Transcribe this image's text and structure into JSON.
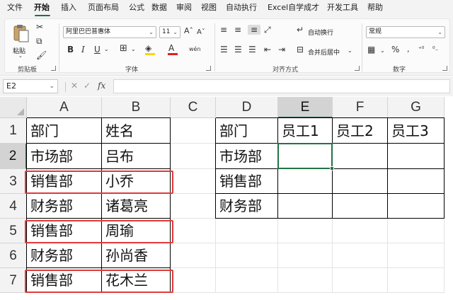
{
  "menu": {
    "items": [
      "文件",
      "开始",
      "插入",
      "页面布局",
      "公式",
      "数据",
      "审阅",
      "视图",
      "自动执行",
      "Excel自学成才",
      "开发工具",
      "帮助"
    ],
    "active_index": 1
  },
  "ribbon": {
    "clipboard": {
      "paste_label": "粘贴",
      "group_label": "剪贴板"
    },
    "font": {
      "font_name": "阿里巴巴普惠体",
      "font_size": "11",
      "group_label": "字体",
      "grow_icon": "Aˆ",
      "shrink_icon": "Aˇ",
      "phonetic_icon": "wén"
    },
    "alignment": {
      "wrap_label": "自动换行",
      "merge_label": "合并后居中",
      "group_label": "对齐方式"
    },
    "number": {
      "format": "常规",
      "group_label": "数字"
    }
  },
  "formula_bar": {
    "name_box": "E2",
    "cancel_icon": "✕",
    "enter_icon": "✓",
    "fx_icon": "fx",
    "formula": ""
  },
  "sheet": {
    "columns": [
      "A",
      "B",
      "C",
      "D",
      "E",
      "F",
      "G"
    ],
    "rows": [
      "1",
      "2",
      "3",
      "4",
      "5",
      "6",
      "7"
    ],
    "active_cell": "E2",
    "cells": {
      "A": [
        "部门",
        "市场部",
        "销售部",
        "财务部",
        "销售部",
        "财务部",
        "销售部"
      ],
      "B": [
        "姓名",
        "吕布",
        "小乔",
        "诸葛亮",
        "周瑜",
        "孙尚香",
        "花木兰"
      ],
      "C": [
        "",
        "",
        "",
        "",
        "",
        "",
        ""
      ],
      "D": [
        "部门",
        "市场部",
        "销售部",
        "财务部",
        "",
        "",
        ""
      ],
      "E": [
        "员工1",
        "",
        "",
        "",
        "",
        "",
        ""
      ],
      "F": [
        "员工2",
        "",
        "",
        "",
        "",
        "",
        ""
      ],
      "G": [
        "员工3",
        "",
        "",
        "",
        "",
        "",
        ""
      ]
    },
    "highlight_color": "#e03a3a",
    "accent_color": "#217346"
  }
}
